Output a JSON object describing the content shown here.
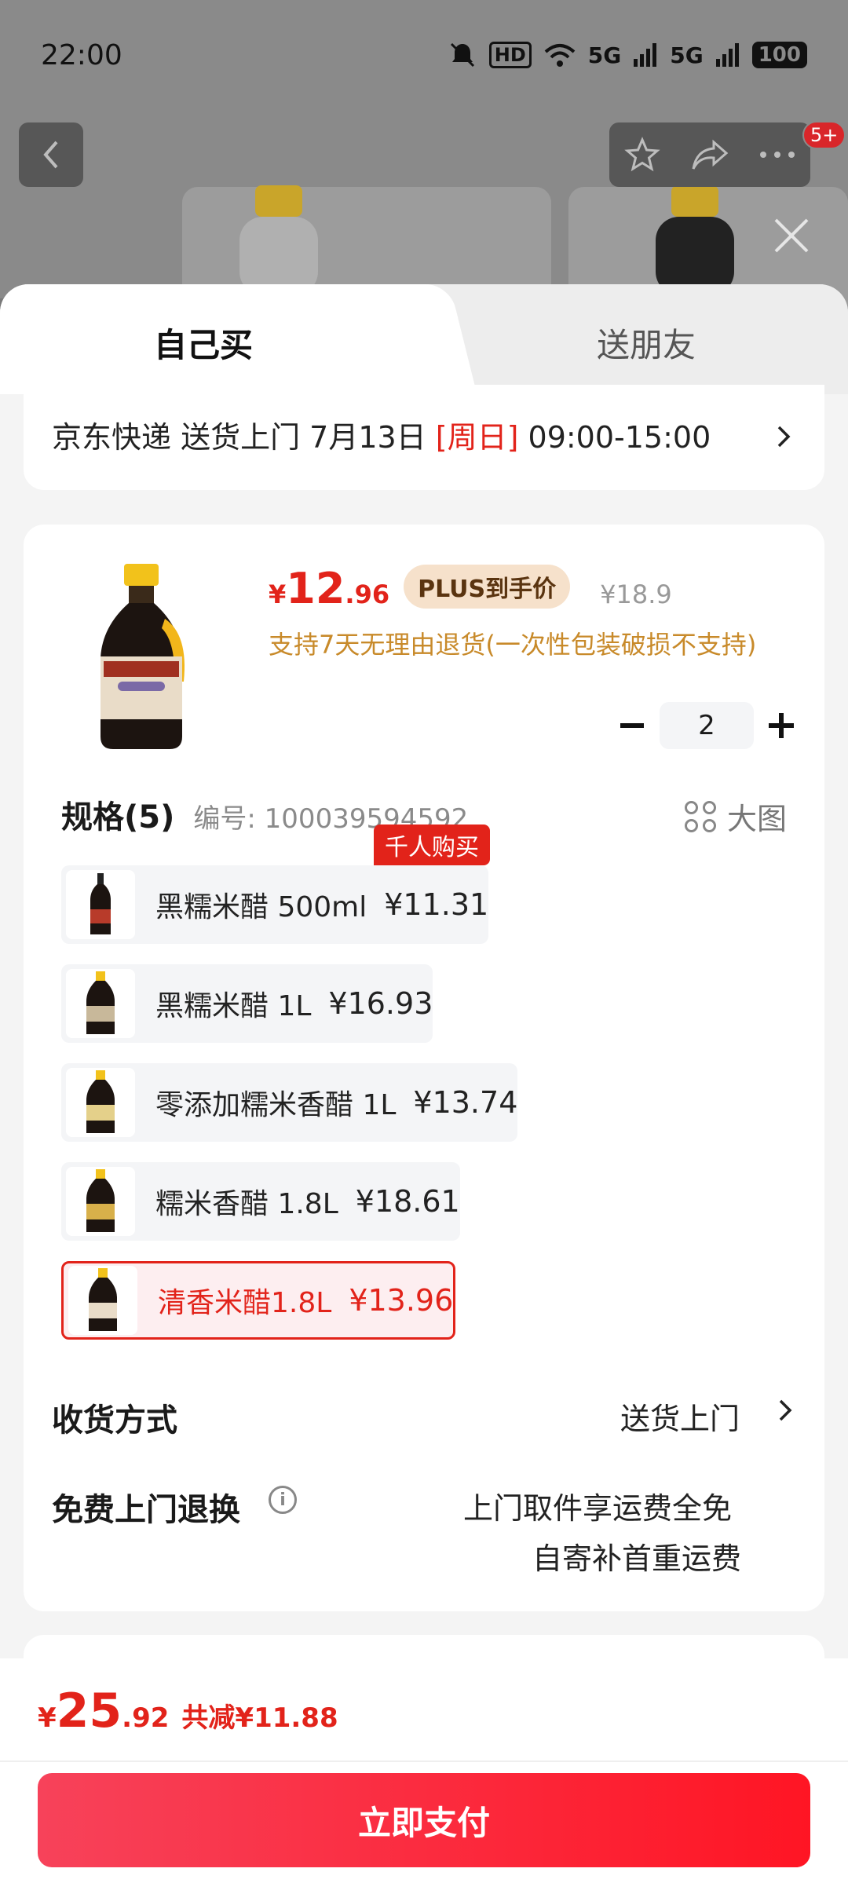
{
  "status_bar": {
    "time": "22:00",
    "hd": "HD",
    "net1": "5G",
    "net2": "5G",
    "battery": "100"
  },
  "top_actions": {
    "notification_badge": "5+"
  },
  "tabs": {
    "self_label": "自己买",
    "friend_label": "送朋友"
  },
  "delivery": {
    "prefix": "京东快递 送货上门 7月13日 ",
    "day": "[周日]",
    "time": " 09:00-15:00"
  },
  "product": {
    "currency": "¥",
    "price_int": "12",
    "price_dec": ".96",
    "plus_tag": "PLUS到手价",
    "original_price": "¥18.9",
    "return_note": "支持7天无理由退货(一次性包装破损不支持)",
    "quantity": "2"
  },
  "specs": {
    "title": "规格(5)",
    "number_label": "编号: 100039594592",
    "big_image_label": "大图",
    "hot_tag": "千人购买",
    "variants": [
      {
        "name": "黑糯米醋 500ml",
        "price": "¥11.31"
      },
      {
        "name": "黑糯米醋 1L",
        "price": "¥16.93"
      },
      {
        "name": "零添加糯米香醋 1L",
        "price": "¥13.74"
      },
      {
        "name": "糯米香醋 1.8L",
        "price": "¥18.61"
      },
      {
        "name": "清香米醋1.8L",
        "price": "¥13.96"
      }
    ]
  },
  "shipping": {
    "label": "收货方式",
    "value": "送货上门"
  },
  "returns": {
    "label": "免费上门退换",
    "line1": "上门取件享运费全免",
    "line2": "自寄补首重运费"
  },
  "footer": {
    "currency": "¥",
    "total_int": "25",
    "total_dec": ".92",
    "saving": "共减¥11.88",
    "pay_label": "立即支付"
  },
  "colors": {
    "accent": "#e2231a",
    "plus_bg": "#f6e1cb",
    "note": "#c88a2a"
  }
}
